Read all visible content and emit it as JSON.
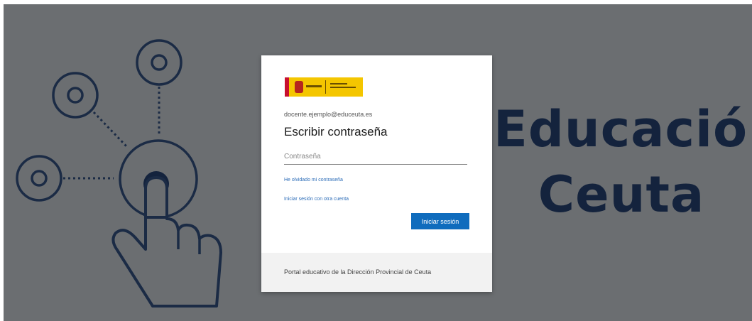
{
  "brand": {
    "line1": "Educación",
    "line2": "Ceuta"
  },
  "card": {
    "logo_alt": "Gobierno de España",
    "email": "docente.ejemplo@educeuta.es",
    "title": "Escribir contraseña",
    "password_placeholder": "Contraseña",
    "forgot_link": "He olvidado mi contraseña",
    "other_account_link": "Iniciar sesión con otra cuenta",
    "signin_button": "Iniciar sesión",
    "footer_text": "Portal educativo de la Dirección Provincial de Ceuta"
  },
  "colors": {
    "background": "#6b6e71",
    "brand_text": "#14233d",
    "primary_button": "#0f6cbd",
    "link": "#2a6bb7"
  },
  "icons": [
    "touch-hand-icon",
    "target-circle-icon"
  ]
}
